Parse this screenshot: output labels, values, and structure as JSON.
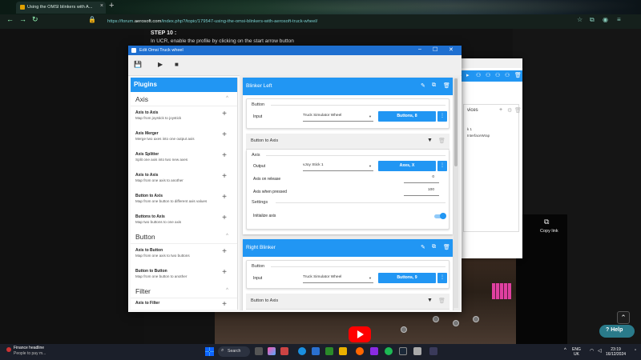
{
  "browser": {
    "tab_title": "Using the OMSI blinkers with A...",
    "tab_close": "×",
    "new_tab": "+",
    "url_pre": "https://forum.",
    "url_domain": "aerosoft.com",
    "url_post": "/index.php?/topic/179547-using-the-omsi-blinkers-with-aerosoft-truck-wheel/",
    "back": "←",
    "forward": "→",
    "reload": "↻"
  },
  "page": {
    "step_title": "STEP 10 :",
    "step_text": "In UCR, enable the profile by clicking on the start arrow button",
    "copy_link": "Copy link",
    "help": "Help"
  },
  "bg_window": {
    "card_title": "vices",
    "line1": "k 1",
    "line2": "InterfaceWrap"
  },
  "window": {
    "title": "Edit Omsi Truck wheel",
    "controls": {
      "min": "–",
      "max": "☐",
      "close": "✕"
    }
  },
  "toolbar": {
    "save_icon": "save-icon",
    "play_icon": "play-icon",
    "stop_icon": "stop-icon"
  },
  "plugins": {
    "header": "Plugins",
    "sections": [
      {
        "label": "Axis",
        "chevron": "^"
      },
      {
        "label": "Button",
        "chevron": "^"
      },
      {
        "label": "Filter",
        "chevron": "^"
      }
    ],
    "items": [
      {
        "title": "Axis to Axis",
        "desc": "Map from joystick to joystick",
        "add": "+"
      },
      {
        "title": "Axis Merger",
        "desc": "Merge two axes into one output axis",
        "add": "+"
      },
      {
        "title": "Axis Splitter",
        "desc": "Split one axis into two new axes",
        "add": "+"
      },
      {
        "title": "Axis to Axis",
        "desc": "Map from one axis to another",
        "add": "+"
      },
      {
        "title": "Button to Axis",
        "desc": "Map from one button to different axis values",
        "add": "+"
      },
      {
        "title": "Buttons to Axis",
        "desc": "Map two buttons to one axis",
        "add": "+"
      },
      {
        "title": "Axis to Button",
        "desc": "Map from one axis to two buttons",
        "add": "+"
      },
      {
        "title": "Button to Button",
        "desc": "Map from one button to another",
        "add": "+"
      },
      {
        "title": "Axis to Filter",
        "desc": "",
        "add": "+"
      }
    ]
  },
  "editor": {
    "blocks": [
      {
        "title": "Blinker Left",
        "button_section": "Button",
        "input_label": "Input",
        "input_device": "Truck Simulator Wheel",
        "input_button": "Buttons, 8",
        "more": "⋮",
        "plugin_title": "Button to Axis",
        "axis_section": "Axis",
        "output_label": "Output",
        "output_device": "vJoy Stick 1",
        "output_axis": "Axes, X",
        "axis_on_release_label": "Axis on release",
        "axis_on_release_value": "0",
        "axis_when_pressed_label": "Axis when pressed",
        "axis_when_pressed_value": "100",
        "settings_section": "Settings",
        "initialize_axis_label": "Initialize axis",
        "initialize_axis_on": true
      },
      {
        "title": "Right Blinker",
        "button_section": "Button",
        "input_label": "Input",
        "input_device": "Truck Simulator Wheel",
        "input_button": "Buttons, 9",
        "more": "⋮",
        "plugin_title": "Button to Axis"
      }
    ]
  },
  "taskbar": {
    "news_title": "Finance headline",
    "news_sub": "People to pay m...",
    "search": "Search",
    "lang1": "ENG",
    "lang2": "UK",
    "time": "23:19",
    "date": "16/12/2024"
  },
  "colors": {
    "accent": "#2196f3",
    "title_bar": "#1e6fd0",
    "youtube": "#ff0000"
  }
}
